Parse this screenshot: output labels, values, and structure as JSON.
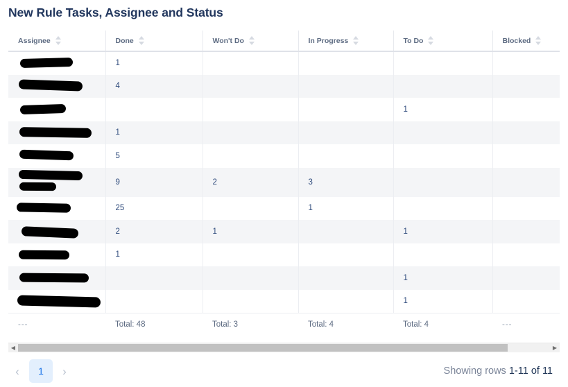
{
  "page_title": "New Rule Tasks, Assignee and Status",
  "colors": {
    "title": "#22375e",
    "header_text": "#5d6b82",
    "cell_text": "#2f4b7c",
    "row_alt": "#f4f5f7",
    "accent": "#1a73e8",
    "pager_active_bg": "#e3effd"
  },
  "table": {
    "sort_icon": "sort-updown-icon",
    "columns": [
      {
        "key": "assignee",
        "label": "Assignee"
      },
      {
        "key": "done",
        "label": "Done"
      },
      {
        "key": "wont_do",
        "label": "Won't Do"
      },
      {
        "key": "in_progress",
        "label": "In Progress"
      },
      {
        "key": "to_do",
        "label": "To Do"
      },
      {
        "key": "blocked",
        "label": "Blocked"
      }
    ],
    "rows": [
      {
        "assignee": "",
        "done": "1",
        "wont_do": "",
        "in_progress": "",
        "to_do": "",
        "blocked": ""
      },
      {
        "assignee": "",
        "done": "4",
        "wont_do": "",
        "in_progress": "",
        "to_do": "",
        "blocked": ""
      },
      {
        "assignee": "",
        "done": "",
        "wont_do": "",
        "in_progress": "",
        "to_do": "1",
        "blocked": ""
      },
      {
        "assignee": "",
        "done": "1",
        "wont_do": "",
        "in_progress": "",
        "to_do": "",
        "blocked": ""
      },
      {
        "assignee": "",
        "done": "5",
        "wont_do": "",
        "in_progress": "",
        "to_do": "",
        "blocked": ""
      },
      {
        "assignee": "",
        "done": "9",
        "wont_do": "2",
        "in_progress": "3",
        "to_do": "",
        "blocked": ""
      },
      {
        "assignee": "",
        "done": "25",
        "wont_do": "",
        "in_progress": "1",
        "to_do": "",
        "blocked": ""
      },
      {
        "assignee": "",
        "done": "2",
        "wont_do": "1",
        "in_progress": "",
        "to_do": "1",
        "blocked": ""
      },
      {
        "assignee": "",
        "done": "1",
        "wont_do": "",
        "in_progress": "",
        "to_do": "",
        "blocked": ""
      },
      {
        "assignee": "",
        "done": "",
        "wont_do": "",
        "in_progress": "",
        "to_do": "1",
        "blocked": ""
      },
      {
        "assignee": "",
        "done": "",
        "wont_do": "",
        "in_progress": "",
        "to_do": "1",
        "blocked": ""
      }
    ],
    "totals": {
      "assignee": "---",
      "done": "Total: 48",
      "wont_do": "Total: 3",
      "in_progress": "Total: 4",
      "to_do": "Total: 4",
      "blocked": "---"
    }
  },
  "scrollbar": {
    "left_arrow": "◀",
    "right_arrow": "▶",
    "thumb_percent": "92"
  },
  "pagination": {
    "prev_label": "‹",
    "next_label": "›",
    "current_page": "1",
    "showing_label": "Showing rows",
    "showing_value": "1-11 of 11"
  }
}
